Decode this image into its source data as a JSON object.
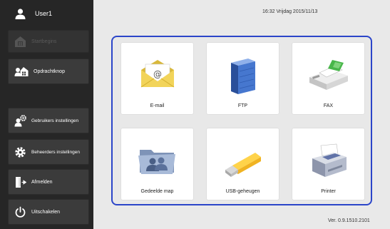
{
  "sidebar": {
    "user": {
      "name": "User1",
      "icon": "user-icon"
    },
    "items": [
      {
        "label": "Startbegins",
        "icon": "home-icon",
        "enabled": false
      },
      {
        "label": "Opdrachtknop",
        "icon": "job-button-icon",
        "enabled": true
      },
      {
        "label": "Gebruikers instellingen",
        "icon": "user-settings-icon",
        "enabled": true
      },
      {
        "label": "Beheerders instellingen",
        "icon": "gear-icon",
        "enabled": true
      },
      {
        "label": "Afmelden",
        "icon": "logout-icon",
        "enabled": true
      },
      {
        "label": "Uitschakelen",
        "icon": "power-icon",
        "enabled": true
      }
    ]
  },
  "header": {
    "datetime": "16:32 Vrijdag 2015/11/13"
  },
  "tiles": [
    {
      "label": "E-mail",
      "icon": "email-icon"
    },
    {
      "label": "FTP",
      "icon": "ftp-server-icon"
    },
    {
      "label": "FAX",
      "icon": "fax-icon"
    },
    {
      "label": "Gedeelde map",
      "icon": "shared-folder-icon"
    },
    {
      "label": "USB-geheugen",
      "icon": "usb-memory-icon"
    },
    {
      "label": "Printer",
      "icon": "printer-icon"
    }
  ],
  "footer": {
    "version": "Ver. 0.9.1510.2101"
  },
  "colors": {
    "sidebar": "#262626",
    "button": "#3b3b3b",
    "frame": "#2b45c9",
    "background": "#e9e9e9"
  }
}
